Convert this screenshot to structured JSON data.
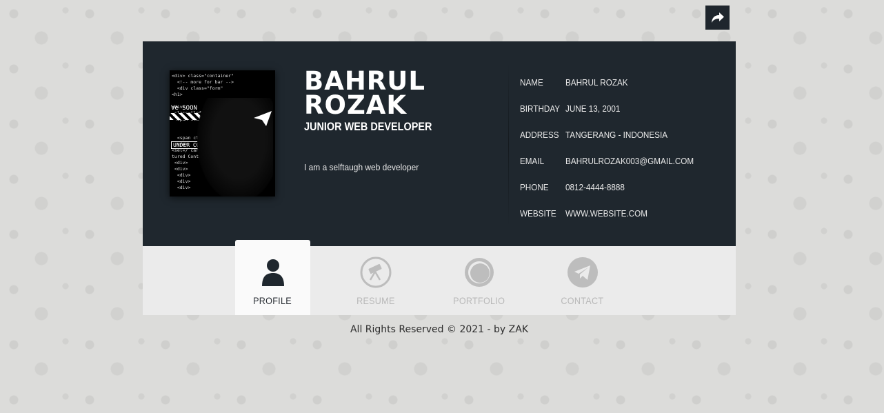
{
  "header": {
    "share_icon": "share-icon"
  },
  "profile": {
    "first_name": "BAHRUL",
    "last_name": "ROZAK",
    "job_title": "JUNIOR WEB DEVELOPER",
    "bio": "I am a selftaugh web developer",
    "photo_text": "Ve SOON",
    "photo_label": "UNDER CONST"
  },
  "info": [
    {
      "label": "NAME",
      "value": "BAHRUL ROZAK"
    },
    {
      "label": "BIRTHDAY",
      "value": "JUNE 13, 2001"
    },
    {
      "label": "ADDRESS",
      "value": "TANGERANG - INDONESIA"
    },
    {
      "label": "EMAIL",
      "value": "BAHRULROZAK003@GMAIL.COM"
    },
    {
      "label": "PHONE",
      "value": "0812-4444-8888"
    },
    {
      "label": "WEBSITE",
      "value": "WWW.WEBSITE.COM"
    }
  ],
  "nav": {
    "tabs": [
      {
        "label": "PROFILE",
        "icon": "user-icon",
        "active": true
      },
      {
        "label": "RESUME",
        "icon": "telescope-icon",
        "active": false
      },
      {
        "label": "PORTFOLIO",
        "icon": "lens-icon",
        "active": false
      },
      {
        "label": "CONTACT",
        "icon": "paper-plane-icon",
        "active": false
      }
    ]
  },
  "footer": {
    "text": "All Rights Reserved © 2021 - by ZAK"
  },
  "colors": {
    "card_dark": "#1f272e",
    "nav_bg": "#ebebeb",
    "active_text": "#2a2f35",
    "inactive_text": "#b8b8b8",
    "page_bg": "#dcdcda"
  }
}
